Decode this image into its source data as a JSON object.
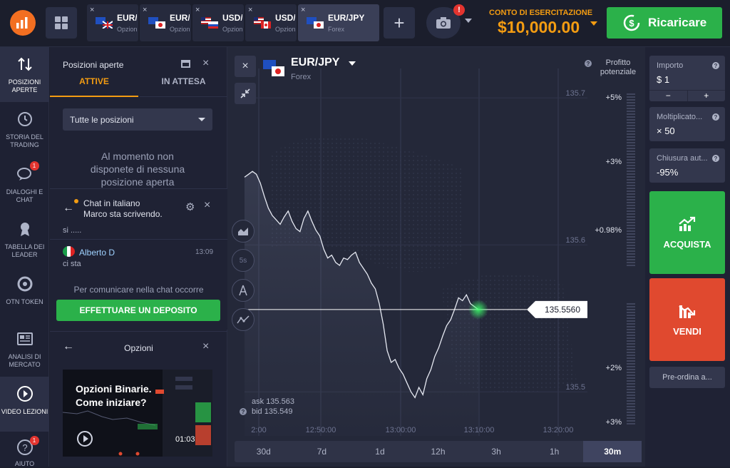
{
  "top": {
    "tabs": [
      {
        "symbol": "EUR/USD",
        "sub": "Opzioni"
      },
      {
        "symbol": "EUR/JPY",
        "sub": "Opzioni"
      },
      {
        "symbol": "USD/RUB",
        "sub": "Opzioni"
      },
      {
        "symbol": "USD/CAD",
        "sub": "Opzioni"
      },
      {
        "symbol": "EUR/JPY",
        "sub": "Forex"
      }
    ],
    "close_glyph": "×",
    "plus_glyph": "+",
    "cam_badge": "!",
    "account_label": "CONTO DI ESERCITAZIONE",
    "account_balance": "$10,000.00",
    "deposit_label": "Ricaricare"
  },
  "nav": [
    {
      "label": "POSIZIONI APERTE",
      "icon": "swap-arrows-icon",
      "badge": ""
    },
    {
      "label": "STORIA DEL TRADING",
      "icon": "history-icon",
      "badge": ""
    },
    {
      "label": "DIALOGHI E CHAT",
      "icon": "chat-icon",
      "badge": "1"
    },
    {
      "label": "TABELLA DEI LEADER",
      "icon": "medal-icon",
      "badge": ""
    },
    {
      "label": "OTN TOKEN",
      "icon": "token-icon",
      "badge": ""
    },
    {
      "label": "ANALISI DI MERCATO",
      "icon": "news-icon",
      "badge": ""
    },
    {
      "label": "VIDEO LEZIONI",
      "icon": "play-icon",
      "badge": ""
    },
    {
      "label": "AIUTO",
      "icon": "help-icon",
      "badge": "1"
    }
  ],
  "positions": {
    "title": "Posizioni aperte",
    "tab_active": "ATTIVE",
    "tab_pending": "IN ATTESA",
    "filter": "Tutte le posizioni",
    "empty": "Al momento non disponete di nessuna posizione aperta"
  },
  "chat": {
    "title": "Chat in italiano",
    "typing": "Marco sta scrivendo.",
    "msg1": "si .....",
    "user": "Alberto D",
    "time": "13:09",
    "msg2": "ci sta",
    "note": "Per comunicare nella chat occorre",
    "deposit": "EFFETTUARE UN DEPOSITO"
  },
  "options": {
    "title": "Opzioni",
    "video_title": "Opzioni Binarie. Come iniziare?",
    "video_time": "01:03"
  },
  "chart": {
    "asset": "EUR/JPY",
    "market": "Forex",
    "profit_label": "Profitto potenziale",
    "ask_label": "ask",
    "ask": "135.563",
    "bid_label": "bid",
    "bid": "135.549",
    "help_glyph": "?"
  },
  "chart_data": {
    "type": "line",
    "x_ticks": [
      "2:00",
      "12:50:00",
      "13:00:00",
      "13:10:00",
      "13:20:00"
    ],
    "y_ticks": [
      "135.7",
      "135.6",
      "135.5"
    ],
    "profit_ticks": [
      "+5%",
      "+3%",
      "+0.98%",
      "+2%",
      "+3%"
    ],
    "current_price": "135.5560",
    "ylim": [
      135.47,
      135.72
    ],
    "y": [
      135.646,
      135.648,
      135.65,
      135.648,
      135.642,
      135.633,
      135.625,
      135.62,
      135.617,
      135.614,
      135.619,
      135.623,
      135.616,
      135.611,
      135.609,
      135.618,
      135.623,
      135.616,
      135.61,
      135.606,
      135.597,
      135.591,
      135.593,
      135.588,
      135.586,
      135.591,
      135.59,
      135.593,
      135.595,
      135.588,
      135.584,
      135.58,
      135.574,
      135.57,
      135.56,
      135.546,
      135.528,
      135.52,
      135.522,
      135.516,
      135.512,
      135.506,
      135.5,
      135.496,
      135.503,
      135.498,
      135.509,
      135.515,
      135.524,
      135.53,
      135.538,
      135.545,
      135.549,
      135.556,
      135.564,
      135.562,
      135.566,
      135.56,
      135.558,
      135.556
    ]
  },
  "timeframes": [
    "30d",
    "7d",
    "1d",
    "12h",
    "3h",
    "1h",
    "30m"
  ],
  "active_timeframe": "30m",
  "right": {
    "amount_label": "Importo",
    "amount_value": "$ 1",
    "minus": "−",
    "plus": "+",
    "mult_label": "Moltiplicato...",
    "mult_value": "× 50",
    "close_label": "Chiusura aut...",
    "close_value": "-95%",
    "buy": "ACQUISTA",
    "sell": "VENDI",
    "preorder": "Pre-ordina a..."
  },
  "colors": {
    "accent": "#f39c12",
    "buy": "#2bb14a",
    "sell": "#e0492f",
    "bg": "#242839"
  }
}
